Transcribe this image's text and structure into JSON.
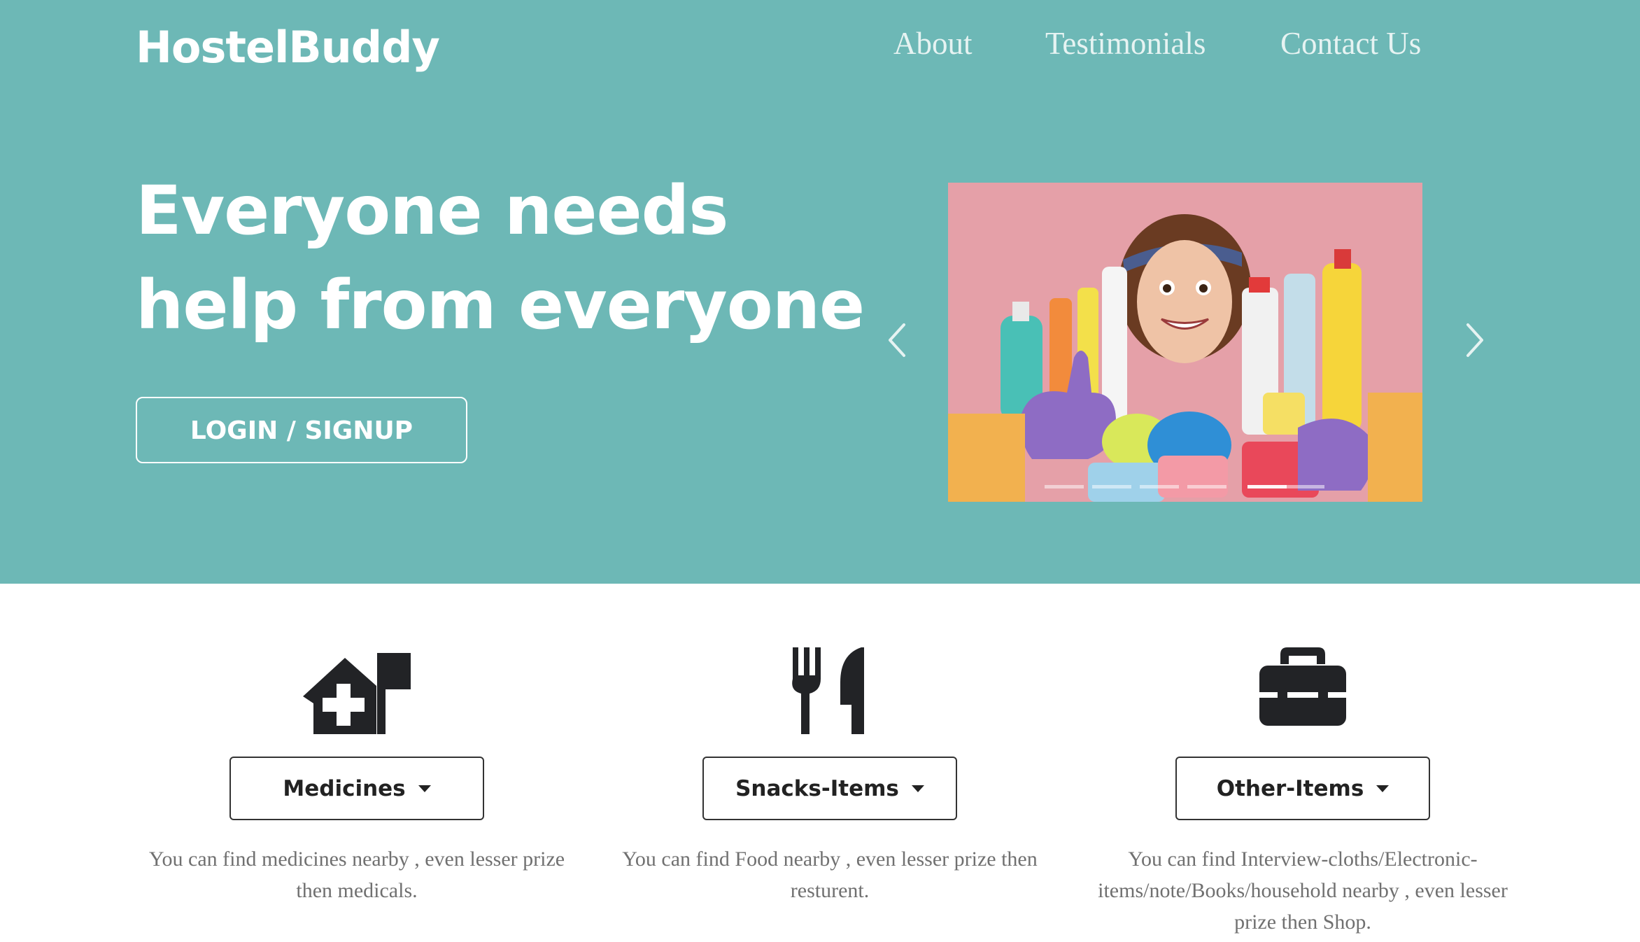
{
  "brand": {
    "logo": "HostelBuddy"
  },
  "nav": {
    "items": [
      "About",
      "Testimonials",
      "Contact Us"
    ]
  },
  "hero": {
    "headline_line1": "Everyone needs",
    "headline_line2": "help from everyone",
    "cta_label": "LOGIN / SIGNUP",
    "carousel": {
      "slide_count": 6,
      "active_index": 4
    }
  },
  "features": [
    {
      "icon": "house-medical-flag-icon",
      "dropdown_label": "Medicines",
      "description": "You can find medicines nearby , even lesser prize then medicals."
    },
    {
      "icon": "utensils-icon",
      "dropdown_label": "Snacks-Items",
      "description": "You can find Food nearby , even lesser prize then resturent."
    },
    {
      "icon": "toolbox-icon",
      "dropdown_label": "Other-Items",
      "description": "You can find Interview-cloths/Electronic-items/note/Books/household nearby , even lesser prize then Shop."
    }
  ],
  "colors": {
    "hero_bg": "#6db8b6",
    "slide_bg": "#e5a0a8",
    "icon": "#222326",
    "text_muted": "#707070"
  }
}
